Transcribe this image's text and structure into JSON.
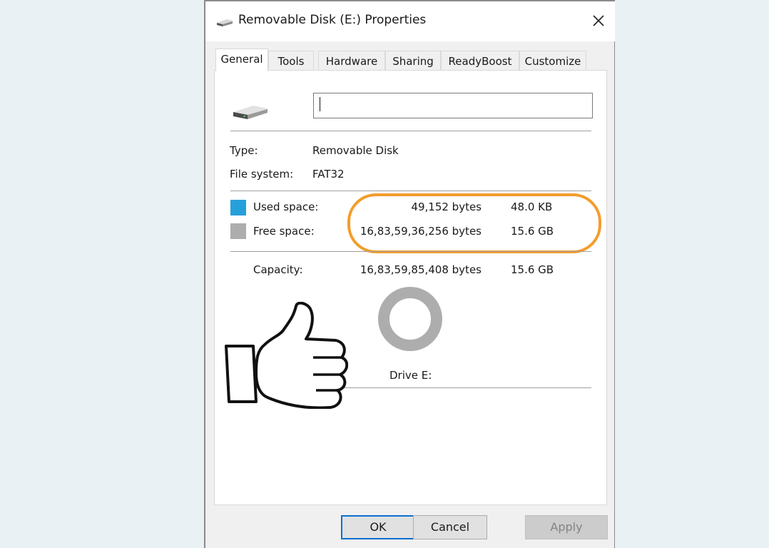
{
  "window": {
    "title": "Removable Disk (E:) Properties",
    "close_label": "Close"
  },
  "tabs": [
    {
      "label": "General",
      "active": true
    },
    {
      "label": "Tools",
      "active": false
    },
    {
      "label": "Hardware",
      "active": false
    },
    {
      "label": "Sharing",
      "active": false
    },
    {
      "label": "ReadyBoost",
      "active": false
    },
    {
      "label": "Customize",
      "active": false
    }
  ],
  "general": {
    "volume_label_value": "",
    "type_label": "Type:",
    "type_value": "Removable Disk",
    "filesystem_label": "File system:",
    "filesystem_value": "FAT32",
    "used": {
      "label": "Used space:",
      "bytes": "49,152 bytes",
      "size": "48.0 KB",
      "color": "#26a0da"
    },
    "free": {
      "label": "Free space:",
      "bytes": "16,83,59,36,256 bytes",
      "size": "15.6 GB",
      "color": "#adadad"
    },
    "capacity": {
      "label": "Capacity:",
      "bytes": "16,83,59,85,408 bytes",
      "size": "15.6 GB"
    },
    "used_fraction": 2.9e-06,
    "drive_label": "Drive E:"
  },
  "annotation": {
    "highlight_color": "#f49c2c",
    "thumbs_up": "thumbs-up-overlay"
  },
  "buttons": {
    "ok": "OK",
    "cancel": "Cancel",
    "apply": "Apply"
  }
}
